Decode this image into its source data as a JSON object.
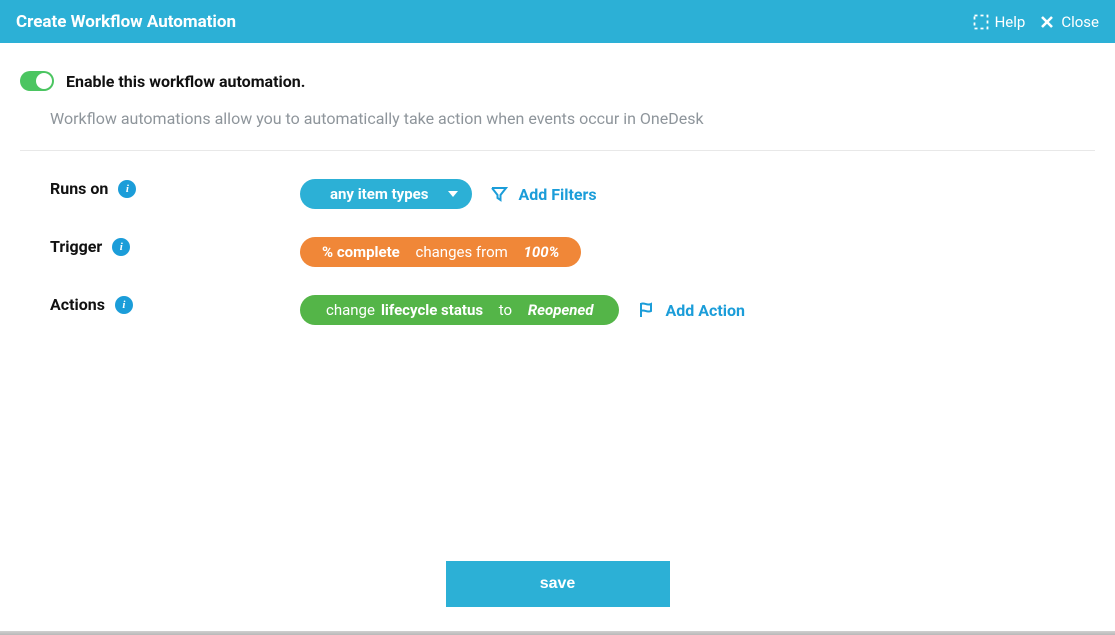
{
  "header": {
    "title": "Create Workflow Automation",
    "help": "Help",
    "close": "Close"
  },
  "enable": {
    "label": "Enable this workflow automation.",
    "state": true
  },
  "description": "Workflow automations allow you to automatically take action when events occur in OneDesk",
  "sections": {
    "runsOn": {
      "label": "Runs on",
      "selected": "any item types",
      "addFilters": "Add Filters"
    },
    "trigger": {
      "label": "Trigger",
      "field": "% complete",
      "verb": "changes from",
      "value": "100%"
    },
    "actions": {
      "label": "Actions",
      "verb": "change",
      "field": "lifecycle status",
      "connector": "to",
      "value": "Reopened",
      "addAction": "Add Action"
    }
  },
  "footer": {
    "save": "save"
  }
}
